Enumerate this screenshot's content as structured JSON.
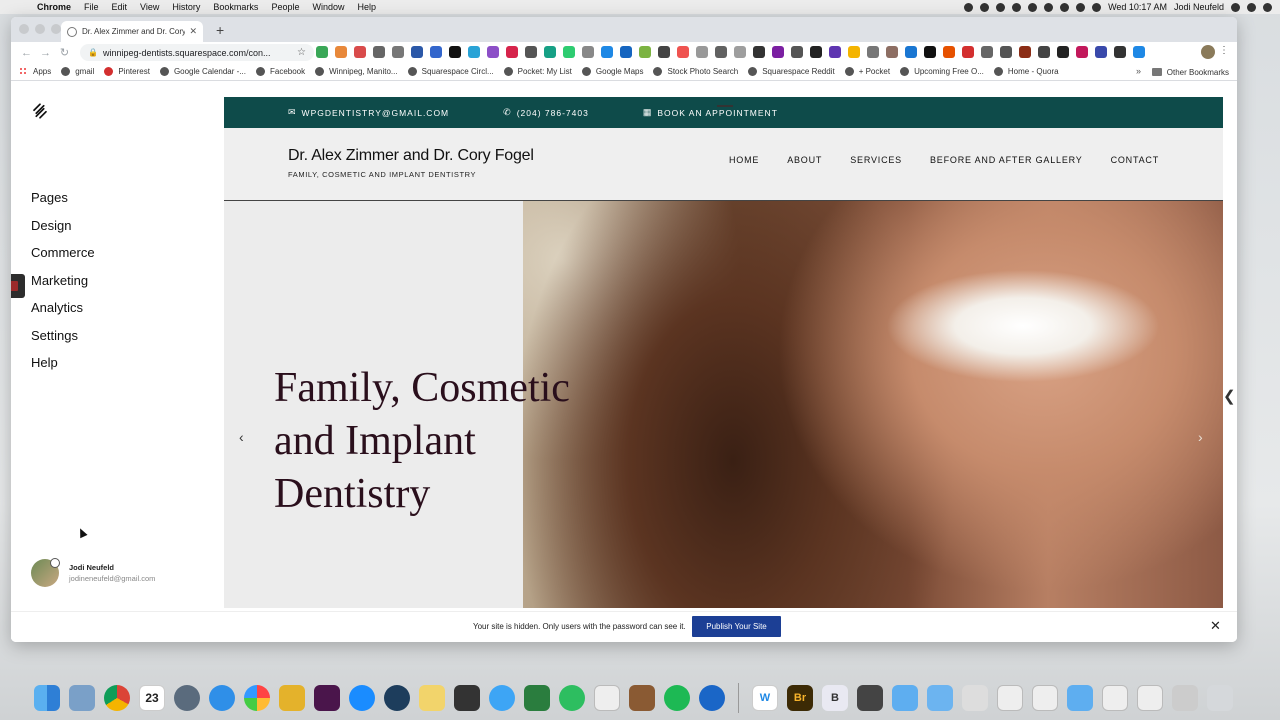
{
  "menubar": {
    "apple": "",
    "items": [
      "Chrome",
      "File",
      "Edit",
      "View",
      "History",
      "Bookmarks",
      "People",
      "Window",
      "Help"
    ],
    "datetime": "Wed 10:17 AM",
    "user": "Jodi Neufeld"
  },
  "browser": {
    "tab_title": "Dr. Alex Zimmer and Dr. Cory F",
    "new_tab": "+",
    "url": "winnipeg-dentists.squarespace.com/con...",
    "bookmarks": [
      "Apps",
      "gmail",
      "Pinterest",
      "Google Calendar -...",
      "Facebook",
      "Winnipeg, Manito...",
      "Squarespace Circl...",
      "Pocket: My List",
      "Google Maps",
      "Stock Photo Search",
      "Squarespace Reddit",
      "+ Pocket",
      "Upcoming Free O...",
      "Home - Quora"
    ],
    "bookmarks_more": "»",
    "other_bookmarks": "Other Bookmarks"
  },
  "sidebar": {
    "nav": [
      "Pages",
      "Design",
      "Commerce",
      "Marketing",
      "Analytics",
      "Settings",
      "Help"
    ],
    "user_name": "Jodi Neufeld",
    "user_email": "jodineneufeld@gmail.com"
  },
  "site": {
    "topbar": {
      "email": "WPGDENTISTRY@GMAIL.COM",
      "phone": "(204) 786-7403",
      "appointment": "BOOK AN APPOINTMENT"
    },
    "title": "Dr. Alex Zimmer and Dr. Cory Fogel",
    "tagline": "FAMILY, COSMETIC AND IMPLANT DENTISTRY",
    "nav": [
      "HOME",
      "ABOUT",
      "SERVICES",
      "BEFORE AND AFTER GALLERY",
      "CONTACT"
    ],
    "hero_heading": "Family, Cosmetic and Implant Dentistry",
    "prev": "‹",
    "next": "›"
  },
  "notice": {
    "text": "Your site is hidden. Only users with the password can see it.",
    "button": "Publish Your Site",
    "close": "✕"
  },
  "colors": {
    "topbar_bg": "#0e4b4a",
    "publish_button": "#1c3f95",
    "hero_heading": "#2a0f1c"
  },
  "dock": {
    "icons": [
      "finder-icon",
      "preview-icon",
      "chrome-icon",
      "calendar-icon",
      "launchpad-icon",
      "safari-icon",
      "photos-icon",
      "photo-app-icon",
      "slack-icon",
      "app-store-icon",
      "quicktime-icon",
      "notes-icon",
      "printer-icon",
      "messages-icon",
      "keynote-icon",
      "evernote-icon",
      "textedit-icon",
      "notebook-icon",
      "spotify-icon",
      "onepassword-icon",
      "word-icon",
      "bridge-icon",
      "bbedit-icon",
      "terminal-icon",
      "folder-icon",
      "folder-icon",
      "help-icon",
      "zip-icon",
      "zip-icon",
      "folder-icon",
      "zip-icon",
      "jpeg-icon",
      "grid-icon",
      "trash-icon"
    ],
    "calendar_day": "23",
    "word_label": "W",
    "bridge_label": "Br",
    "bbedit_label": "B"
  }
}
